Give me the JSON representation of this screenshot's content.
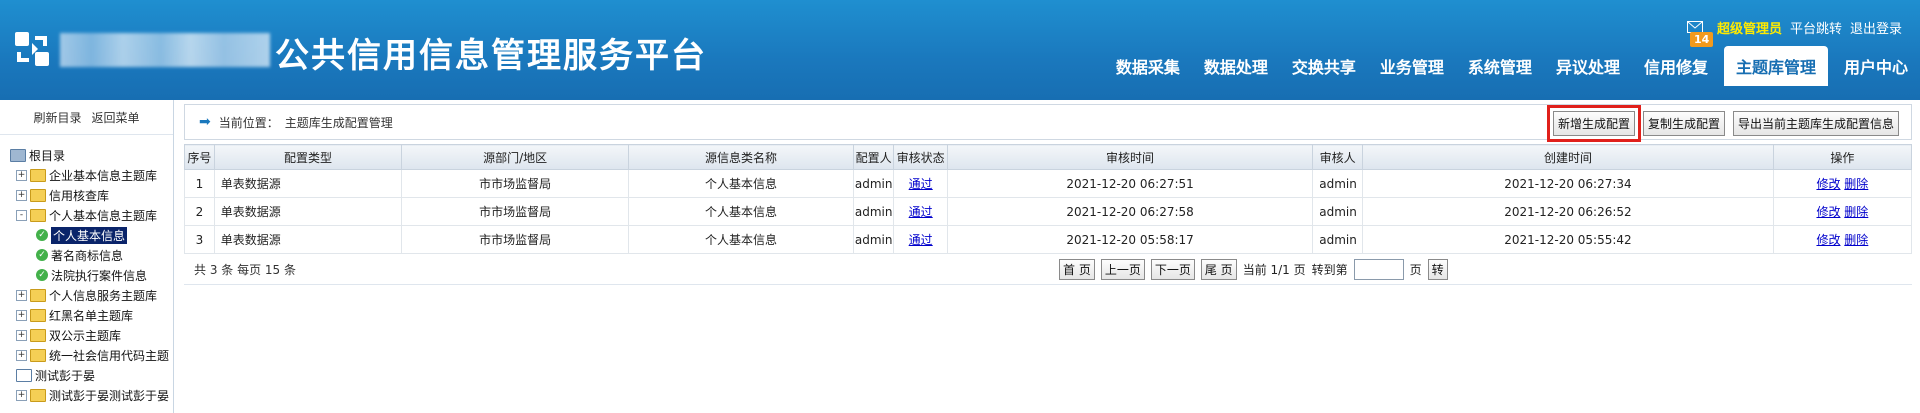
{
  "header": {
    "title": "公共信用信息管理服务平台",
    "mail_count": "14",
    "role": "超级管理员",
    "platform_jump": "平台跳转",
    "logout": "退出登录",
    "nav": [
      "数据采集",
      "数据处理",
      "交换共享",
      "业务管理",
      "系统管理",
      "异议处理",
      "信用修复",
      "主题库管理",
      "用户中心"
    ],
    "active_nav": "主题库管理"
  },
  "sidebar": {
    "refresh": "刷新目录",
    "back": "返回菜单",
    "tree": [
      {
        "label": "根目录",
        "level": 0,
        "icon": "root-icon"
      },
      {
        "label": "企业基本信息主题库",
        "level": 1,
        "icon": "folder-icon",
        "expander": "+"
      },
      {
        "label": "信用核查库",
        "level": 1,
        "icon": "folder-icon",
        "expander": "+"
      },
      {
        "label": "个人基本信息主题库",
        "level": 1,
        "icon": "folder-icon",
        "expander": "-"
      },
      {
        "label": "个人基本信息",
        "level": 2,
        "icon": "check-icon",
        "selected": true
      },
      {
        "label": "著名商标信息",
        "level": 2,
        "icon": "check-icon"
      },
      {
        "label": "法院执行案件信息",
        "level": 2,
        "icon": "check-icon"
      },
      {
        "label": "个人信息服务主题库",
        "level": 1,
        "icon": "folder-icon",
        "expander": "+"
      },
      {
        "label": "红黑名单主题库",
        "level": 1,
        "icon": "folder-icon",
        "expander": "+"
      },
      {
        "label": "双公示主题库",
        "level": 1,
        "icon": "folder-icon",
        "expander": "+"
      },
      {
        "label": "统一社会信用代码主题",
        "level": 1,
        "icon": "folder-icon",
        "expander": "+"
      },
      {
        "label": "测试彭于晏",
        "level": 1,
        "icon": "doc-icon"
      },
      {
        "label": "测试彭于晏测试彭于晏",
        "level": 1,
        "icon": "folder-icon",
        "expander": "+"
      }
    ]
  },
  "crumb": {
    "label": "当前位置：",
    "path": "主题库生成配置管理"
  },
  "toolbar": {
    "add_label": "新增生成配置",
    "copy_label": "复制生成配置",
    "export_label": "导出当前主题库生成配置信息"
  },
  "table": {
    "headers": [
      "序号",
      "配置类型",
      "源部门/地区",
      "源信息类名称",
      "配置人",
      "审核状态",
      "审核时间",
      "审核人",
      "创建时间",
      "操作"
    ],
    "rows": [
      {
        "no": "1",
        "type": "单表数据源",
        "dept": "市市场监督局",
        "info": "个人基本信息",
        "by": "admin",
        "status": "通过",
        "audit_time": "2021-12-20 06:27:51",
        "auditor": "admin",
        "create_time": "2021-12-20 06:27:34",
        "edit": "修改",
        "del": "删除"
      },
      {
        "no": "2",
        "type": "单表数据源",
        "dept": "市市场监督局",
        "info": "个人基本信息",
        "by": "admin",
        "status": "通过",
        "audit_time": "2021-12-20 06:27:58",
        "auditor": "admin",
        "create_time": "2021-12-20 06:26:52",
        "edit": "修改",
        "del": "删除"
      },
      {
        "no": "3",
        "type": "单表数据源",
        "dept": "市市场监督局",
        "info": "个人基本信息",
        "by": "admin",
        "status": "通过",
        "audit_time": "2021-12-20 05:58:17",
        "auditor": "admin",
        "create_time": "2021-12-20 05:55:42",
        "edit": "修改",
        "del": "删除"
      }
    ]
  },
  "pager": {
    "total": "共 3 条  每页  15  条",
    "first": "首 页",
    "prev": "上一页",
    "next": "下一页",
    "last": "尾 页",
    "current": "当前 1/1 页",
    "goto": "转到第",
    "page_unit": "页",
    "go": "转",
    "input_value": ""
  },
  "colors": {
    "header": "#1a78bd",
    "highlight": "#e0201b",
    "role": "#ffea00",
    "badge": "#f39a1c"
  }
}
